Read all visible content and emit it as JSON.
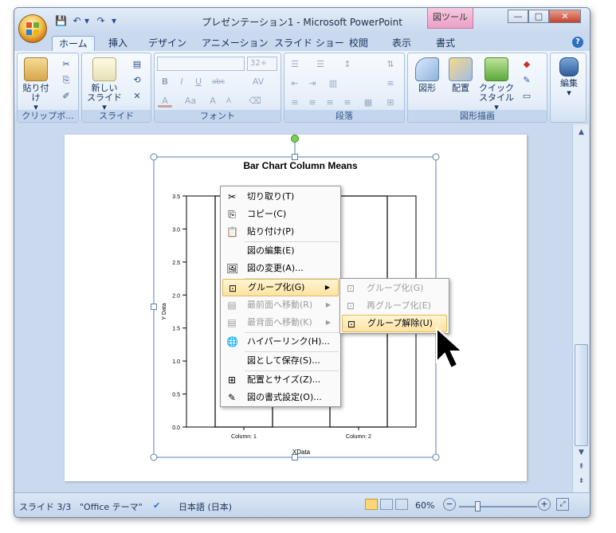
{
  "window": {
    "title": "プレゼンテーション1 - Microsoft PowerPoint",
    "context_tab": "図ツール",
    "controls": {
      "minimize": "—",
      "maximize": "□",
      "close": "✕"
    }
  },
  "qat": {
    "save": "💾",
    "undo": "↶",
    "redo": "↷",
    "more": "▾"
  },
  "tabs": [
    {
      "label": "ホーム",
      "active": true
    },
    {
      "label": "挿入"
    },
    {
      "label": "デザイン"
    },
    {
      "label": "アニメーション"
    },
    {
      "label": "スライド ショー"
    },
    {
      "label": "校閲"
    },
    {
      "label": "表示"
    },
    {
      "label": "書式"
    }
  ],
  "help": "?",
  "ribbon": {
    "clipboard": {
      "label": "クリップボ...",
      "paste": "貼り付け",
      "paste2": "▾"
    },
    "slides": {
      "label": "スライド",
      "new_slide": "新しい",
      "new_slide2": "スライド ▾"
    },
    "font": {
      "label": "フォント",
      "size": "32+",
      "bold": "B",
      "italic": "I",
      "underline": "U",
      "strike": "abc",
      "spacing": "AV",
      "color": "A",
      "aa": "Aa",
      "grow": "A",
      "shrink": "A"
    },
    "paragraph": {
      "label": "段落"
    },
    "drawing": {
      "label": "図形描画",
      "shapes": "図形",
      "arrange": "配置",
      "quick_style": "クイック",
      "quick_style2": "スタイル ▾"
    },
    "editing": {
      "label": "編集",
      "launcher": "▾"
    }
  },
  "chart_data": {
    "type": "bar",
    "title": "Bar Chart Column Means",
    "xlabel": "XData",
    "ylabel": "Y Data",
    "categories": [
      "Column: 1",
      "Column: 2"
    ],
    "ylim": [
      0,
      3.5
    ],
    "yticks": [
      "0.0",
      "0.5",
      "1.0",
      "1.5",
      "2.0",
      "2.5",
      "3.0",
      "3.5"
    ],
    "grid": false
  },
  "context_menu": {
    "items": [
      {
        "label": "切り取り(T)",
        "icon": "✂"
      },
      {
        "label": "コピー(C)",
        "icon": "⎘"
      },
      {
        "label": "貼り付け(P)",
        "icon": "📋"
      },
      {
        "label": "図の編集(E)",
        "icon": ""
      },
      {
        "label": "図の変更(A)...",
        "icon": "🖼"
      },
      {
        "label": "グループ化(G)",
        "icon": "⊡",
        "arrow": "▶"
      },
      {
        "label": "最前面へ移動(R)",
        "icon": "▤",
        "arrow": "▶"
      },
      {
        "label": "最背面へ移動(K)",
        "icon": "▤",
        "arrow": "▶"
      },
      {
        "label": "ハイパーリンク(H)...",
        "icon": "🌐"
      },
      {
        "label": "図として保存(S)...",
        "icon": ""
      },
      {
        "label": "配置とサイズ(Z)...",
        "icon": "⊞"
      },
      {
        "label": "図の書式設定(O)...",
        "icon": "✎"
      }
    ]
  },
  "submenu": {
    "items": [
      {
        "label": "グループ化(G)",
        "icon": "⊡"
      },
      {
        "label": "再グループ化(E)",
        "icon": "⊡"
      },
      {
        "label": "グループ解除(U)",
        "icon": "⊡"
      }
    ]
  },
  "statusbar": {
    "slide": "スライド 3/3",
    "theme": "\"Office テーマ\"",
    "language": "日本語 (日本)",
    "zoom": "60%",
    "zoom_out": "−",
    "zoom_in": "+"
  },
  "scroll": {
    "up": "▲",
    "down": "▼",
    "prev": "⇞",
    "next": "⇟"
  },
  "colors": {
    "accent": "#2f6fbf",
    "highlight": "#fde3a3",
    "selection": "#4a7bb8"
  }
}
